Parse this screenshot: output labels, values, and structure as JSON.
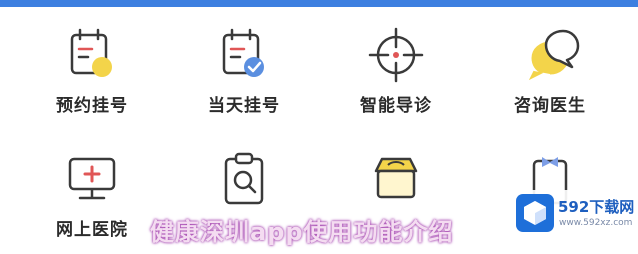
{
  "app": {
    "accent_color": "#3d7fe0",
    "icon_yellow": "#f3d44a",
    "icon_outline": "#3a3a3a"
  },
  "menu": {
    "row1": [
      {
        "label": "预约挂号",
        "icon": "calendar-yellow-dot-icon"
      },
      {
        "label": "当天挂号",
        "icon": "calendar-check-icon"
      },
      {
        "label": "智能导诊",
        "icon": "crosshair-icon"
      },
      {
        "label": "咨询医生",
        "icon": "chat-bubbles-icon"
      }
    ],
    "row2": [
      {
        "label": "网上医院",
        "icon": "monitor-cross-icon"
      },
      {
        "label": "",
        "icon": "clipboard-search-icon"
      },
      {
        "label": "",
        "icon": "shop-icon"
      },
      {
        "label": "",
        "icon": "document-bow-icon"
      }
    ]
  },
  "overlay": {
    "caption": "健康深圳app使用功能介绍"
  },
  "watermark": {
    "name": "592下载网",
    "url": "www.592xz.com",
    "icon": "cube-logo-icon"
  }
}
